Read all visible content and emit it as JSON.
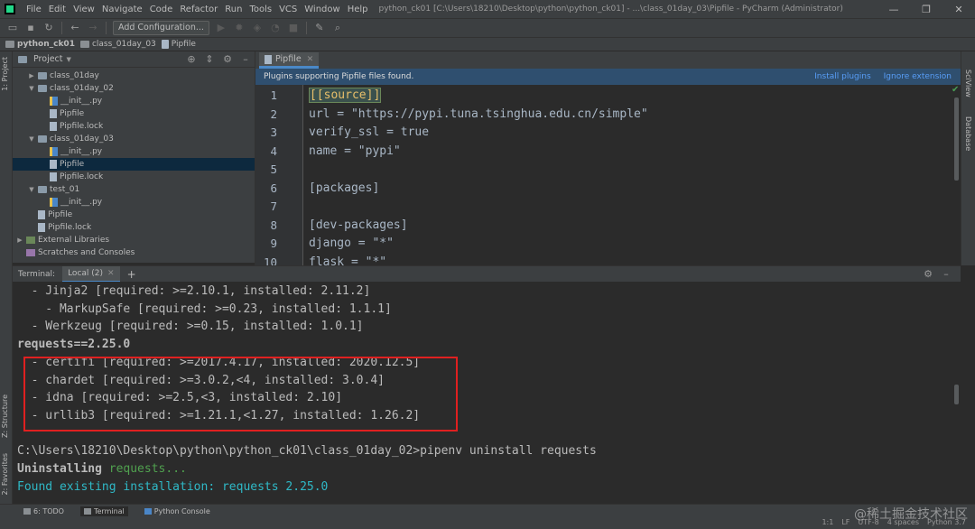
{
  "window": {
    "title": "python_ck01 [C:\\Users\\18210\\Desktop\\python\\python_ck01] - ...\\class_01day_03\\Pipfile - PyCharm (Administrator)",
    "menu": [
      "File",
      "Edit",
      "View",
      "Navigate",
      "Code",
      "Refactor",
      "Run",
      "Tools",
      "VCS",
      "Window",
      "Help"
    ]
  },
  "toolbar": {
    "add_config_label": "Add Configuration..."
  },
  "breadcrumb": [
    "python_ck01",
    "class_01day_03",
    "Pipfile"
  ],
  "left_strip": {
    "project": "1: Project",
    "structure": "Z: Structure",
    "favorites": "2: Favorites"
  },
  "right_strip": {
    "sciview": "SciView",
    "database": "Database"
  },
  "project": {
    "title": "Project",
    "tree": [
      {
        "label": "class_01day",
        "kind": "folder",
        "depth": 1,
        "expanded": false
      },
      {
        "label": "class_01day_02",
        "kind": "folder",
        "depth": 1,
        "expanded": true
      },
      {
        "label": "__init__.py",
        "kind": "py",
        "depth": 2
      },
      {
        "label": "Pipfile",
        "kind": "file",
        "depth": 2
      },
      {
        "label": "Pipfile.lock",
        "kind": "file",
        "depth": 2
      },
      {
        "label": "class_01day_03",
        "kind": "folder",
        "depth": 1,
        "expanded": true
      },
      {
        "label": "__init__.py",
        "kind": "py",
        "depth": 2
      },
      {
        "label": "Pipfile",
        "kind": "file",
        "depth": 2,
        "selected": true
      },
      {
        "label": "Pipfile.lock",
        "kind": "file",
        "depth": 2
      },
      {
        "label": "test_01",
        "kind": "folder",
        "depth": 1,
        "expanded": true
      },
      {
        "label": "__init__.py",
        "kind": "py",
        "depth": 2
      },
      {
        "label": "Pipfile",
        "kind": "file",
        "depth": 1
      },
      {
        "label": "Pipfile.lock",
        "kind": "file",
        "depth": 1
      },
      {
        "label": "External Libraries",
        "kind": "lib",
        "depth": 0,
        "expanded": false
      },
      {
        "label": "Scratches and Consoles",
        "kind": "scratch",
        "depth": 0
      }
    ]
  },
  "editor": {
    "tab": "Pipfile",
    "banner": {
      "message": "Plugins supporting Pipfile files found.",
      "install": "Install plugins",
      "ignore": "Ignore extension"
    },
    "lines": [
      {
        "n": "1",
        "text": "[[source]]",
        "bracket": true
      },
      {
        "n": "2",
        "text": "url = \"https://pypi.tuna.tsinghua.edu.cn/simple\""
      },
      {
        "n": "3",
        "text": "verify_ssl = true"
      },
      {
        "n": "4",
        "text": "name = \"pypi\""
      },
      {
        "n": "5",
        "text": ""
      },
      {
        "n": "6",
        "text": "[packages]"
      },
      {
        "n": "7",
        "text": ""
      },
      {
        "n": "8",
        "text": "[dev-packages]"
      },
      {
        "n": "9",
        "text": "django = \"*\""
      },
      {
        "n": "10",
        "text": "flask = \"*\""
      }
    ]
  },
  "terminal": {
    "label": "Terminal:",
    "tab": "Local (2)",
    "lines": [
      {
        "text": "  - Jinja2 [required: >=2.10.1, installed: 2.11.2]"
      },
      {
        "text": "    - MarkupSafe [required: >=0.23, installed: 1.1.1]"
      },
      {
        "text": "  - Werkzeug [required: >=0.15, installed: 1.0.1]"
      },
      {
        "text": "requests==2.25.0",
        "bold": true
      },
      {
        "text": "  - certifi [required: >=2017.4.17, installed: 2020.12.5]"
      },
      {
        "text": "  - chardet [required: >=3.0.2,<4, installed: 3.0.4]"
      },
      {
        "text": "  - idna [required: >=2.5,<3, installed: 2.10]"
      },
      {
        "text": "  - urllib3 [required: >=1.21.1,<1.27, installed: 1.26.2]"
      },
      {
        "text": ""
      },
      {
        "text": "C:\\Users\\18210\\Desktop\\python\\python_ck01\\class_01day_02>pipenv uninstall requests"
      },
      {
        "text": "Uninstalling",
        "bold": true,
        "suffix": " requests...",
        "suffix_color": "green"
      },
      {
        "text": "Found existing installation: requests 2.25.0",
        "color": "cyan"
      }
    ]
  },
  "bottom_tabs": [
    "6: TODO",
    "Terminal",
    "Python Console"
  ],
  "status": {
    "pos": "1:1",
    "eol": "LF",
    "enc": "UTF-8",
    "indent": "4 spaces",
    "interp": "Python 3.7"
  },
  "watermark": "@稀土掘金技术社区",
  "colors": {
    "accent": "#4a88c7",
    "highlight_box": "#e02020",
    "banner": "#2f4f6f"
  }
}
